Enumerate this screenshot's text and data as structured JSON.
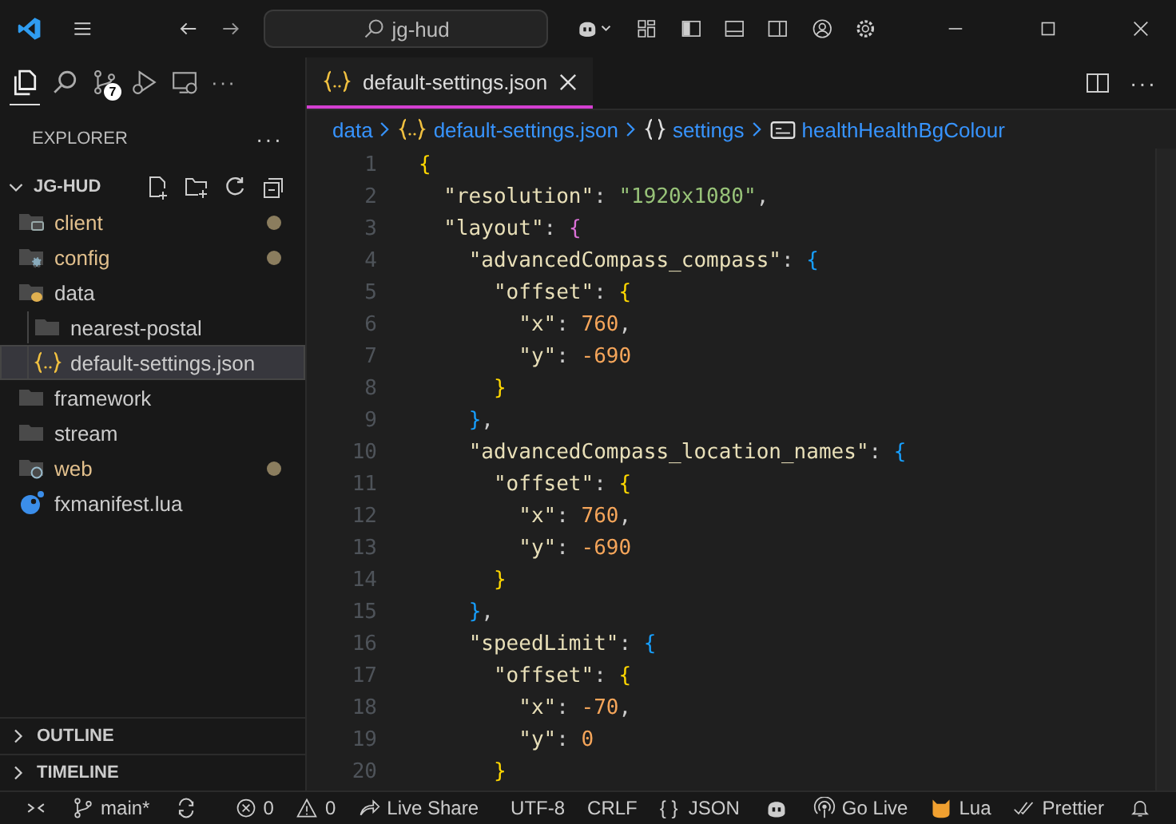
{
  "title_bar": {
    "search": "jg-hud"
  },
  "activity": {
    "items": [
      {
        "kind": "files",
        "selected": true
      },
      {
        "kind": "search",
        "selected": false
      },
      {
        "kind": "scm",
        "selected": false,
        "badge": "7"
      },
      {
        "kind": "run",
        "selected": false
      },
      {
        "kind": "remote",
        "selected": false
      },
      {
        "kind": "more",
        "selected": false,
        "label": "···"
      }
    ]
  },
  "sidebar": {
    "title": "EXPLORER",
    "more": "···",
    "folder": {
      "name": "JG-HUD",
      "expanded": true
    },
    "items": [
      {
        "name": "client",
        "kind": "windowfolder",
        "modified": true,
        "selected": false
      },
      {
        "name": "config",
        "kind": "gearfolder",
        "modified": true,
        "selected": false
      },
      {
        "name": "data",
        "kind": "dbfolder",
        "modified": false,
        "selected": false,
        "children": [
          {
            "name": "nearest-postal",
            "kind": "folder",
            "modified": false,
            "selected": false
          },
          {
            "name": "default-settings.json",
            "kind": "json",
            "modified": false,
            "selected": true
          }
        ]
      },
      {
        "name": "framework",
        "kind": "folder",
        "modified": false,
        "selected": false
      },
      {
        "name": "stream",
        "kind": "folder",
        "modified": false,
        "selected": false
      },
      {
        "name": "web",
        "kind": "globefolder",
        "modified": true,
        "selected": false
      },
      {
        "name": "fxmanifest.lua",
        "kind": "lua",
        "modified": false,
        "selected": false
      }
    ],
    "sections": [
      {
        "name": "OUTLINE",
        "expanded": false
      },
      {
        "name": "TIMELINE",
        "expanded": false
      }
    ]
  },
  "tabs": [
    {
      "label": "default-settings.json",
      "selected": true
    }
  ],
  "more": "···",
  "breadcrumbs": [
    {
      "label": "data"
    },
    {
      "label": "default-settings.json"
    },
    {
      "label": "settings"
    },
    {
      "label": "healthHealthBgColour"
    }
  ],
  "editor": {
    "lines": [
      {
        "n": "1",
        "tokens": [
          {
            "kind": "brace",
            "t": "{",
            "color": "#ffd700"
          }
        ]
      },
      {
        "n": "2",
        "tokens": [
          {
            "kind": "key",
            "t": "  \"resolution\""
          },
          {
            "kind": "punc",
            "t": ": "
          },
          {
            "kind": "str",
            "t": "\"1920x1080\""
          },
          {
            "kind": "punc",
            "t": ","
          }
        ]
      },
      {
        "n": "3",
        "tokens": [
          {
            "kind": "key",
            "t": "  \"layout\""
          },
          {
            "kind": "punc",
            "t": ": "
          },
          {
            "kind": "brace",
            "t": "{",
            "color": "#da70d6"
          }
        ]
      },
      {
        "n": "4",
        "tokens": [
          {
            "kind": "key",
            "t": "    \"advancedCompass_compass\""
          },
          {
            "kind": "punc",
            "t": ": "
          },
          {
            "kind": "brace",
            "t": "{",
            "color": "#179fff"
          }
        ]
      },
      {
        "n": "5",
        "tokens": [
          {
            "kind": "key",
            "t": "      \"offset\""
          },
          {
            "kind": "punc",
            "t": ": "
          },
          {
            "kind": "brace",
            "t": "{",
            "color": "#ffd700"
          }
        ]
      },
      {
        "n": "6",
        "tokens": [
          {
            "kind": "key",
            "t": "        \"x\""
          },
          {
            "kind": "punc",
            "t": ": "
          },
          {
            "kind": "num",
            "t": "760"
          },
          {
            "kind": "punc",
            "t": ","
          }
        ]
      },
      {
        "n": "7",
        "tokens": [
          {
            "kind": "key",
            "t": "        \"y\""
          },
          {
            "kind": "punc",
            "t": ": "
          },
          {
            "kind": "num",
            "t": "-690"
          }
        ]
      },
      {
        "n": "8",
        "tokens": [
          {
            "kind": "brace",
            "t": "      }",
            "color": "#ffd700"
          }
        ]
      },
      {
        "n": "9",
        "tokens": [
          {
            "kind": "brace",
            "t": "    }",
            "color": "#179fff"
          },
          {
            "kind": "punc",
            "t": ","
          }
        ]
      },
      {
        "n": "10",
        "tokens": [
          {
            "kind": "key",
            "t": "    \"advancedCompass_location_names\""
          },
          {
            "kind": "punc",
            "t": ": "
          },
          {
            "kind": "brace",
            "t": "{",
            "color": "#179fff"
          }
        ]
      },
      {
        "n": "11",
        "tokens": [
          {
            "kind": "key",
            "t": "      \"offset\""
          },
          {
            "kind": "punc",
            "t": ": "
          },
          {
            "kind": "brace",
            "t": "{",
            "color": "#ffd700"
          }
        ]
      },
      {
        "n": "12",
        "tokens": [
          {
            "kind": "key",
            "t": "        \"x\""
          },
          {
            "kind": "punc",
            "t": ": "
          },
          {
            "kind": "num",
            "t": "760"
          },
          {
            "kind": "punc",
            "t": ","
          }
        ]
      },
      {
        "n": "13",
        "tokens": [
          {
            "kind": "key",
            "t": "        \"y\""
          },
          {
            "kind": "punc",
            "t": ": "
          },
          {
            "kind": "num",
            "t": "-690"
          }
        ]
      },
      {
        "n": "14",
        "tokens": [
          {
            "kind": "brace",
            "t": "      }",
            "color": "#ffd700"
          }
        ]
      },
      {
        "n": "15",
        "tokens": [
          {
            "kind": "brace",
            "t": "    }",
            "color": "#179fff"
          },
          {
            "kind": "punc",
            "t": ","
          }
        ]
      },
      {
        "n": "16",
        "tokens": [
          {
            "kind": "key",
            "t": "    \"speedLimit\""
          },
          {
            "kind": "punc",
            "t": ": "
          },
          {
            "kind": "brace",
            "t": "{",
            "color": "#179fff"
          }
        ]
      },
      {
        "n": "17",
        "tokens": [
          {
            "kind": "key",
            "t": "      \"offset\""
          },
          {
            "kind": "punc",
            "t": ": "
          },
          {
            "kind": "brace",
            "t": "{",
            "color": "#ffd700"
          }
        ]
      },
      {
        "n": "18",
        "tokens": [
          {
            "kind": "key",
            "t": "        \"x\""
          },
          {
            "kind": "punc",
            "t": ": "
          },
          {
            "kind": "num",
            "t": "-70"
          },
          {
            "kind": "punc",
            "t": ","
          }
        ]
      },
      {
        "n": "19",
        "tokens": [
          {
            "kind": "key",
            "t": "        \"y\""
          },
          {
            "kind": "punc",
            "t": ": "
          },
          {
            "kind": "num",
            "t": "0"
          }
        ]
      },
      {
        "n": "20",
        "tokens": [
          {
            "kind": "brace",
            "t": "      }",
            "color": "#ffd700"
          }
        ]
      }
    ]
  },
  "status_bar": {
    "left": [
      {
        "kind": "remote"
      },
      {
        "kind": "branch",
        "label": "main*"
      },
      {
        "kind": "sync"
      },
      {
        "kind": "errors",
        "label": "0"
      },
      {
        "kind": "warnings",
        "label": "0"
      },
      {
        "kind": "liveshare",
        "label": "Live Share"
      }
    ],
    "right": [
      {
        "kind": "text",
        "label": "UTF-8"
      },
      {
        "kind": "text",
        "label": "CRLF"
      },
      {
        "kind": "text",
        "label": "{ }  JSON"
      },
      {
        "kind": "copilot"
      },
      {
        "kind": "golive",
        "label": "Go Live"
      },
      {
        "kind": "lua",
        "label": "Lua"
      },
      {
        "kind": "prettier",
        "label": "Prettier"
      },
      {
        "kind": "bell"
      }
    ]
  }
}
